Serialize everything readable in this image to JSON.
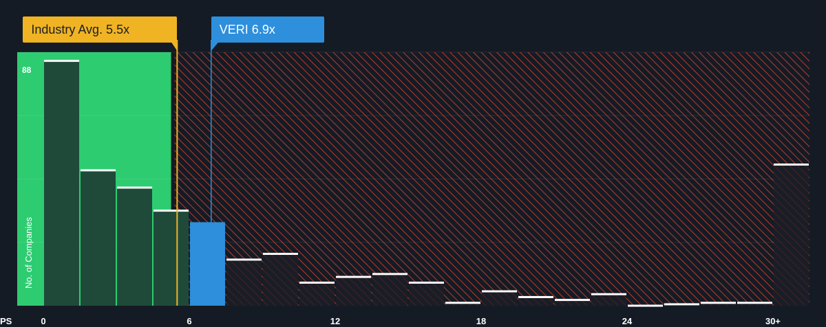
{
  "chart_data": {
    "type": "bar",
    "xlabel": "PS",
    "ylabel": "No. of Companies",
    "y_max_label": "88",
    "ylim": [
      0,
      88
    ],
    "x_tick_labels": [
      "0",
      "6",
      "12",
      "18",
      "24",
      "30+"
    ],
    "x_tick_values": [
      0,
      6,
      12,
      18,
      24,
      30
    ],
    "bin_width": 1.5,
    "bins": [
      {
        "x0": 0.0,
        "value": 85
      },
      {
        "x0": 1.5,
        "value": 47
      },
      {
        "x0": 3.0,
        "value": 41
      },
      {
        "x0": 4.5,
        "value": 33
      },
      {
        "x0": 6.0,
        "value": 29,
        "highlight": true
      },
      {
        "x0": 7.5,
        "value": 16
      },
      {
        "x0": 9.0,
        "value": 18
      },
      {
        "x0": 10.5,
        "value": 8
      },
      {
        "x0": 12.0,
        "value": 10
      },
      {
        "x0": 13.5,
        "value": 11
      },
      {
        "x0": 15.0,
        "value": 8
      },
      {
        "x0": 16.5,
        "value": 1
      },
      {
        "x0": 18.0,
        "value": 5
      },
      {
        "x0": 19.5,
        "value": 3
      },
      {
        "x0": 21.0,
        "value": 2
      },
      {
        "x0": 22.5,
        "value": 4
      },
      {
        "x0": 24.0,
        "value": 0
      },
      {
        "x0": 25.5,
        "value": 0.5
      },
      {
        "x0": 27.0,
        "value": 1
      },
      {
        "x0": 28.5,
        "value": 1
      },
      {
        "x0": 30.0,
        "value": 49
      }
    ],
    "industry_avg": {
      "label": "Industry Avg. 5.5x",
      "value": 5.5
    },
    "company": {
      "label": "VERI 6.9x",
      "value": 6.9
    },
    "colors": {
      "background": "#151b24",
      "fair_zone": "#2ecc71",
      "fair_bar": "#1f4a3a",
      "expensive_hatch": "#c0392b",
      "industry": "#f0b323",
      "company": "#2e8fdc",
      "bar_cap": "#ffffff"
    }
  }
}
